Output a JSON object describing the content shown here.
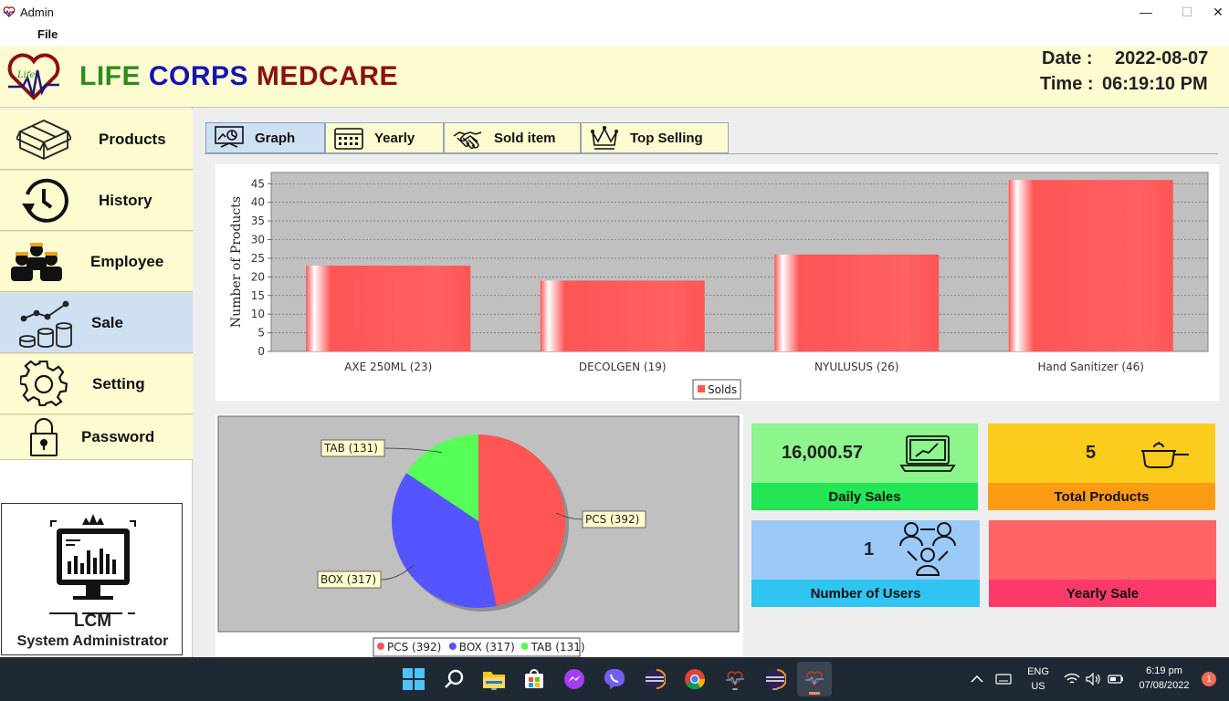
{
  "window": {
    "title": "Admin",
    "minimize": "—",
    "maximize": "☐",
    "close": "✕"
  },
  "menu": {
    "file": "File"
  },
  "header": {
    "brand": {
      "word1": "LIFE",
      "word2": "CORPS",
      "word3": "MEDCARE"
    },
    "date_label": "Date :",
    "date_value": "2022-08-07",
    "time_label": "Time :",
    "time_value": "06:19:10 PM"
  },
  "sidebar": {
    "items": [
      {
        "label": "Products",
        "icon": "box-icon"
      },
      {
        "label": "History",
        "icon": "history-icon"
      },
      {
        "label": "Employee",
        "icon": "employees-icon"
      },
      {
        "label": "Sale",
        "icon": "sale-chart-icon",
        "active": true
      },
      {
        "label": "Setting",
        "icon": "gear-icon"
      },
      {
        "label": "Password",
        "icon": "lock-icon"
      }
    ],
    "profile": {
      "short_name": "LCM",
      "role": "System Administrator"
    }
  },
  "tabs": [
    {
      "label": "Graph",
      "icon": "presentation-icon",
      "active": true
    },
    {
      "label": "Yearly",
      "icon": "calendar-icon"
    },
    {
      "label": "Sold item",
      "icon": "handshake-icon"
    },
    {
      "label": "Top Selling",
      "icon": "crown-icon"
    }
  ],
  "cards": {
    "daily_sales": {
      "value": "16,000.57",
      "label": "Daily Sales",
      "top": "#8cf58c",
      "bottom": "#22e655"
    },
    "total_products": {
      "value": "5",
      "label": "Total Products",
      "top": "#fccc1c",
      "bottom": "#fb9b14"
    },
    "users": {
      "value": "1",
      "label": "Number of Users",
      "top": "#9ccaf8",
      "bottom": "#2fc5f0"
    },
    "yearly_sale": {
      "value": "",
      "label": "Yearly Sale",
      "top": "#fe6464",
      "bottom": "#fc3a6a"
    }
  },
  "chart_data": [
    {
      "type": "bar",
      "categories": [
        "AXE 250ML (23)",
        "DECOLGEN (19)",
        "NYULUSUS (26)",
        "Hand Sanitizer (46)"
      ],
      "values": [
        23,
        19,
        26,
        46
      ],
      "ylabel": "Number of Products",
      "xlabel": "",
      "ylim": [
        0,
        48
      ],
      "yticks": [
        0,
        5,
        10,
        15,
        20,
        25,
        30,
        35,
        40,
        45
      ],
      "series": [
        {
          "name": "Solds",
          "values": [
            23,
            19,
            26,
            46
          ]
        }
      ],
      "legend": "bottom",
      "grid": true,
      "color": "#ff5555"
    },
    {
      "type": "pie",
      "slices": [
        {
          "label": "PCS (392)",
          "name": "PCS",
          "value": 392,
          "color": "#ff5555"
        },
        {
          "label": "BOX (317)",
          "name": "BOX",
          "value": 317,
          "color": "#5555ff"
        },
        {
          "label": "TAB (131)",
          "name": "TAB",
          "value": 131,
          "color": "#55ff55"
        }
      ],
      "legend": "bottom",
      "legend_items": [
        "PCS (392)",
        "BOX (317)",
        "TAB (131)"
      ]
    }
  ],
  "taskbar": {
    "lang_top": "ENG",
    "lang_bottom": "US",
    "time": "6:19 pm",
    "date": "07/08/2022",
    "notifications": "1",
    "apps": [
      "start-icon",
      "search-icon",
      "file-explorer-icon",
      "store-icon",
      "messenger-icon",
      "viber-icon",
      "eclipse-icon",
      "chrome-icon",
      "java-app-icon",
      "eclipse-icon-2",
      "java-app-icon-2"
    ]
  }
}
